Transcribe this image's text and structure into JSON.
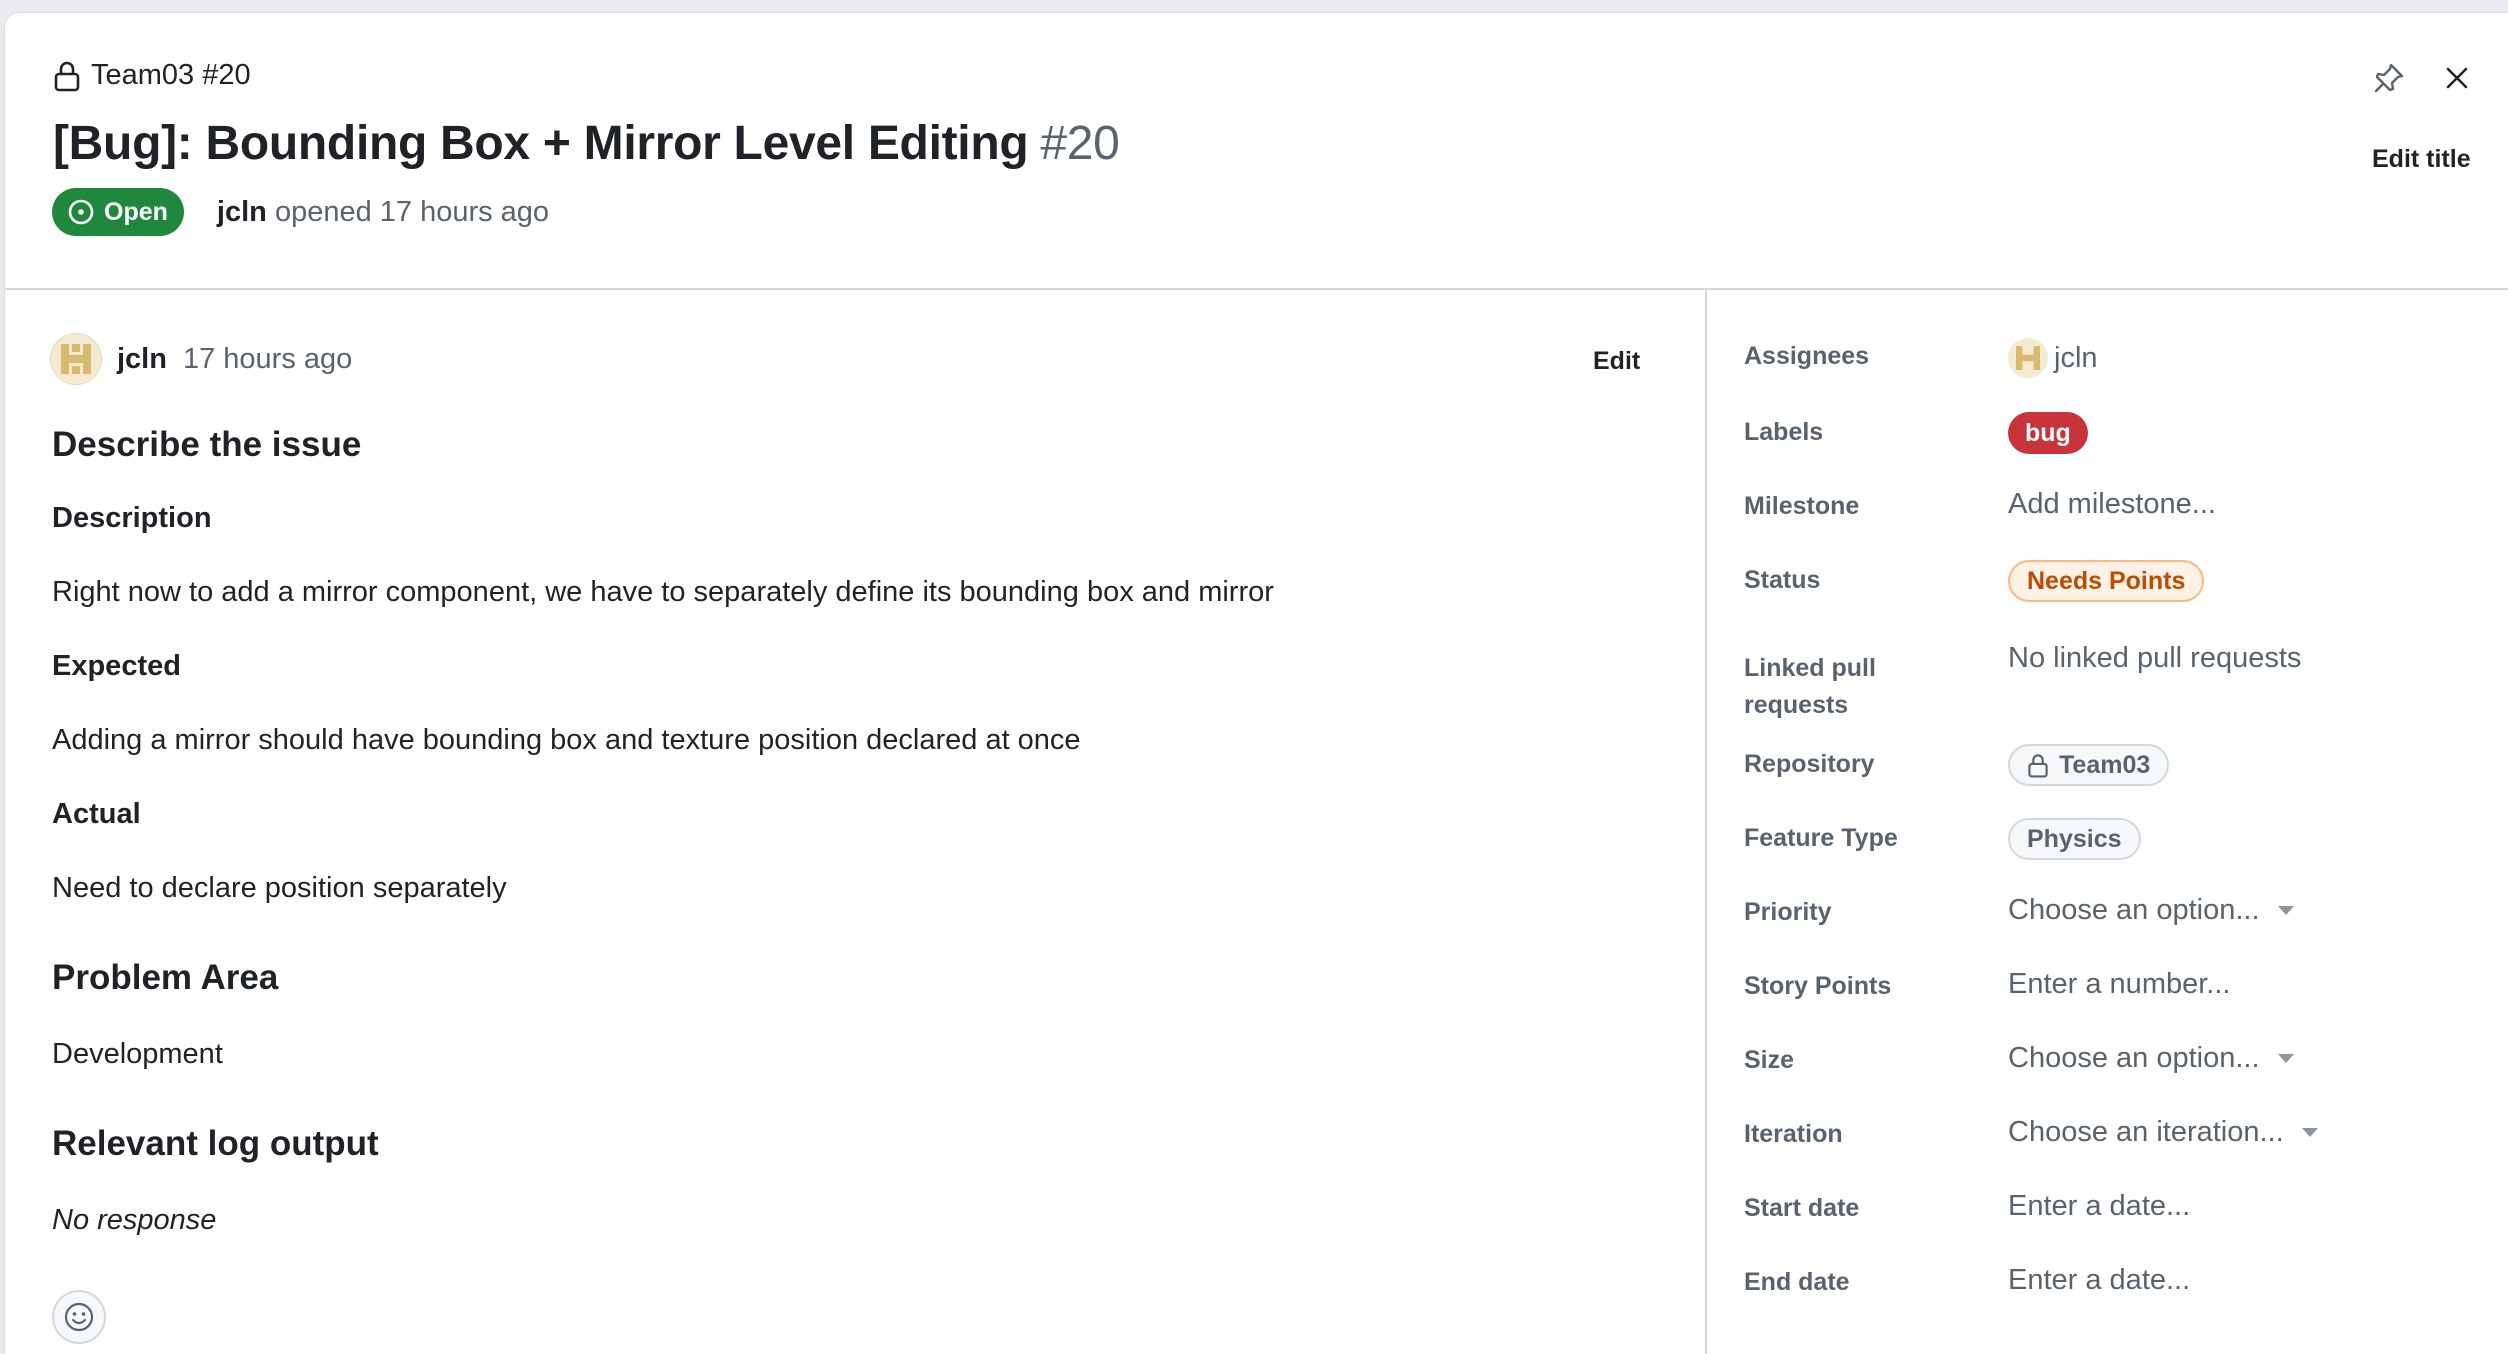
{
  "header": {
    "breadcrumb": "Team03 #20",
    "title": "[Bug]: Bounding Box + Mirror Level Editing",
    "number": "#20",
    "state": "Open",
    "author": "jcln",
    "opened_text": "opened 17 hours ago",
    "edit_title": "Edit title"
  },
  "comment": {
    "author": "jcln",
    "time": "17 hours ago",
    "edit_label": "Edit",
    "describe_heading": "Describe the issue",
    "description_label": "Description",
    "description_text": "Right now to add a mirror component, we have to separately define its bounding box and mirror",
    "expected_label": "Expected",
    "expected_text": "Adding a mirror should have bounding box and texture position declared at once",
    "actual_label": "Actual",
    "actual_text": "Need to declare position separately",
    "problem_area_heading": "Problem Area",
    "problem_area_text": "Development",
    "log_heading": "Relevant log output",
    "log_text": "No response"
  },
  "sidebar": {
    "assignees_label": "Assignees",
    "assignees_value": "jcln",
    "labels_label": "Labels",
    "labels_value": "bug",
    "milestone_label": "Milestone",
    "milestone_value": "Add milestone...",
    "status_label": "Status",
    "status_value": "Needs Points",
    "linked_label": "Linked pull requests",
    "linked_value": "No linked pull requests",
    "repository_label": "Repository",
    "repository_value": "Team03",
    "feature_label": "Feature Type",
    "feature_value": "Physics",
    "priority_label": "Priority",
    "priority_value": "Choose an option...",
    "story_label": "Story Points",
    "story_value": "Enter a number...",
    "size_label": "Size",
    "size_value": "Choose an option...",
    "iteration_label": "Iteration",
    "iteration_value": "Choose an iteration...",
    "start_label": "Start date",
    "start_value": "Enter a date...",
    "end_label": "End date",
    "end_value": "Enter a date..."
  },
  "colors": {
    "open_green": "#1f883d",
    "bug_red": "#c9333b",
    "needs_points_orange": "#bc4c00"
  },
  "icons": [
    "lock-icon",
    "issue-open-icon",
    "pin-icon",
    "close-icon",
    "smiley-icon"
  ]
}
